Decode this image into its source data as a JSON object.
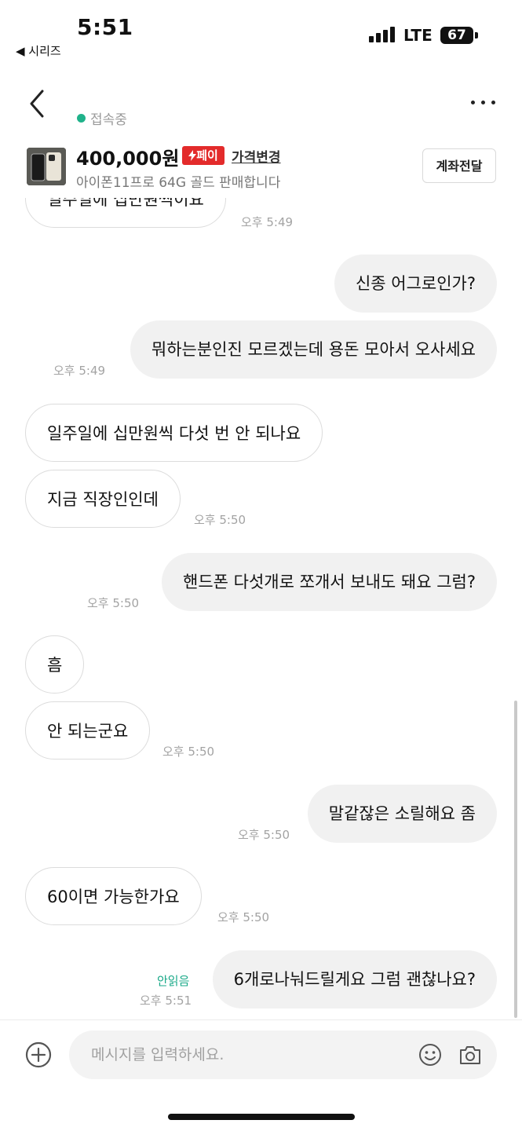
{
  "status_bar": {
    "time": "5:51",
    "back_app": "◀ 시리즈",
    "network": "LTE",
    "battery": "67"
  },
  "header": {
    "status_text": "접속중"
  },
  "product": {
    "price": "400,000원",
    "pay_badge": "페이",
    "price_change": "가격변경",
    "title": "아이폰11프로 64G 골드 판매합니다",
    "transfer_button": "계좌전달"
  },
  "chat": {
    "messages": [
      {
        "side": "in",
        "text": "일주일에 십만원씩이요",
        "time": "오후 5:49"
      },
      {
        "side": "out",
        "text": "신종 어그로인가?",
        "time": ""
      },
      {
        "side": "out",
        "text": "뭐하는분인진 모르겠는데 용돈 모아서 오사세요",
        "time": "오후 5:49"
      },
      {
        "side": "in",
        "text": "일주일에 십만원씩 다섯 번 안 되나요",
        "time": ""
      },
      {
        "side": "in",
        "text": "지금 직장인인데",
        "time": "오후 5:50"
      },
      {
        "side": "out",
        "text": "핸드폰 다섯개로 쪼개서 보내도 돼요 그럼?",
        "time": "오후 5:50"
      },
      {
        "side": "in",
        "text": "흠",
        "time": ""
      },
      {
        "side": "in",
        "text": "안 되는군요",
        "time": "오후 5:50"
      },
      {
        "side": "out",
        "text": "말같잖은 소릴해요 좀",
        "time": "오후 5:50"
      },
      {
        "side": "in",
        "text": "60이면 가능한가요",
        "time": "오후 5:50"
      },
      {
        "side": "out",
        "text": "6개로나눠드릴게요 그럼 괜찮나요?",
        "time": "오후 5:51",
        "read_status": "안읽음"
      }
    ]
  },
  "input": {
    "placeholder": "메시지를 입력하세요."
  },
  "colors": {
    "accent_green": "#1fb28a",
    "pay_red": "#e32b2b",
    "outgoing_bubble": "#f1f1f1"
  },
  "icons": [
    "back-arrow-icon",
    "more-icon",
    "plus-icon",
    "emoji-icon",
    "camera-icon",
    "bolt-icon"
  ]
}
